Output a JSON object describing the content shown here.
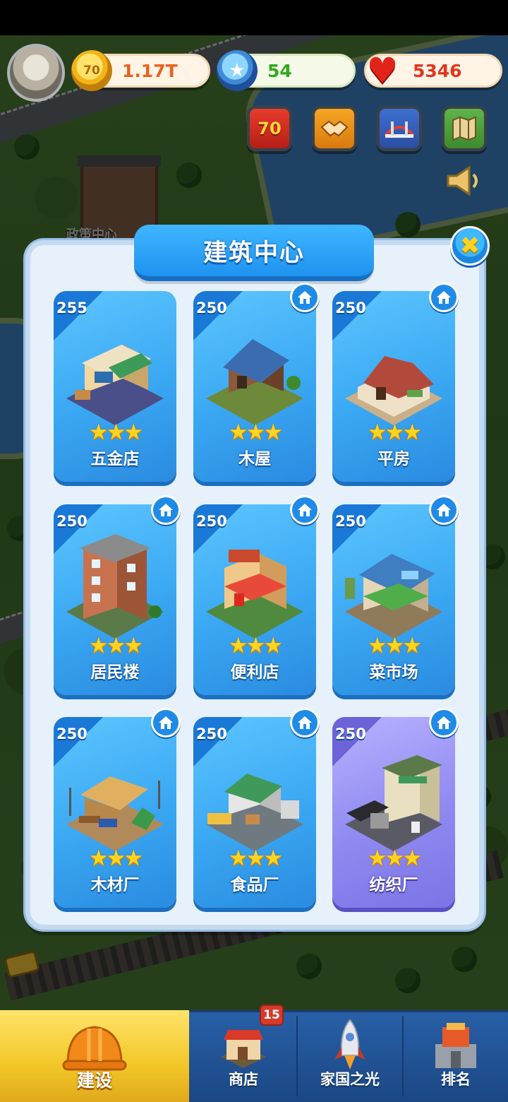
{
  "hud": {
    "coins": "1.17T",
    "coin_icon_text": "70",
    "gems": "54",
    "hearts": "5346",
    "event_button_text": "70",
    "policy_center_label": "政策中心"
  },
  "panel": {
    "title": "建筑中心",
    "close_symbol": "✖"
  },
  "buildings": [
    {
      "level": "255",
      "name": "五金店",
      "stars": 3,
      "has_home_badge": false
    },
    {
      "level": "250",
      "name": "木屋",
      "stars": 3,
      "has_home_badge": true
    },
    {
      "level": "250",
      "name": "平房",
      "stars": 3,
      "has_home_badge": true
    },
    {
      "level": "250",
      "name": "居民楼",
      "stars": 3,
      "has_home_badge": true
    },
    {
      "level": "250",
      "name": "便利店",
      "stars": 3,
      "has_home_badge": true
    },
    {
      "level": "250",
      "name": "菜市场",
      "stars": 3,
      "has_home_badge": true
    },
    {
      "level": "250",
      "name": "木材厂",
      "stars": 3,
      "has_home_badge": true
    },
    {
      "level": "250",
      "name": "食品厂",
      "stars": 3,
      "has_home_badge": true
    },
    {
      "level": "250",
      "name": "纺织厂",
      "stars": 3,
      "has_home_badge": true
    }
  ],
  "stars_text": "★★★",
  "bottom_nav": {
    "build": "建设",
    "shop": "商店",
    "shop_badge": "15",
    "homeland": "家国之光",
    "ranking": "排名"
  },
  "colors": {
    "card_blue": "#3aa7f2",
    "card_purple": "#8f8af0",
    "star_yellow": "#ffd41f",
    "nav_active": "#f2c728"
  }
}
